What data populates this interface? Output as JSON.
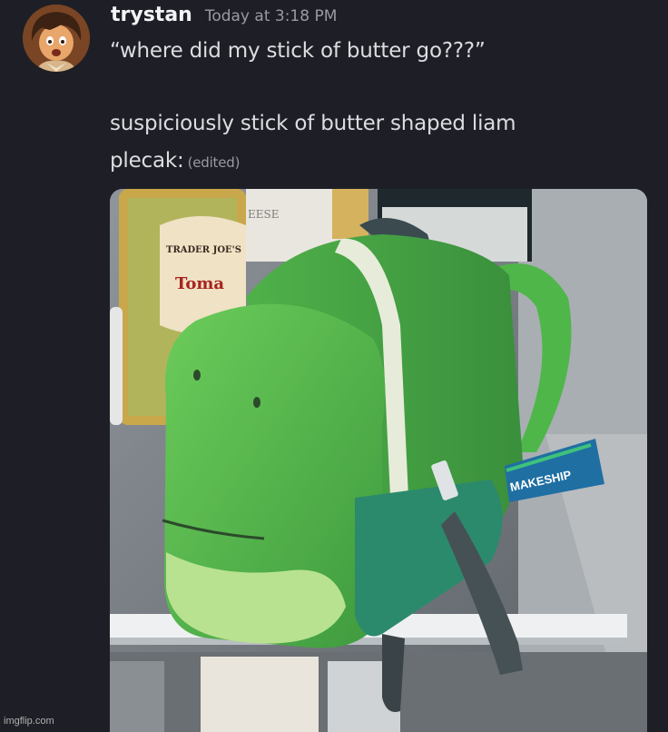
{
  "message": {
    "username": "trystan",
    "timestamp": "Today at 3:18 PM",
    "lines": [
      "“where did my stick of butter go???”",
      "suspiciously stick of butter shaped liam",
      "plecak:"
    ],
    "edited_label": "(edited)"
  },
  "attachment": {
    "jar_label_brand": "TRADER JOE'S",
    "jar_label_partial": "Toma",
    "tag_text": "MAKESHIP",
    "container_label": "EESE"
  },
  "watermark": "imgflip.com",
  "colors": {
    "background": "#1e1f26",
    "username": "#f2f3f5",
    "timestamp": "#9a9ba1",
    "message_text": "#dcdde1",
    "plush_green": "#4caf50",
    "tag_blue": "#1f6fa3"
  }
}
